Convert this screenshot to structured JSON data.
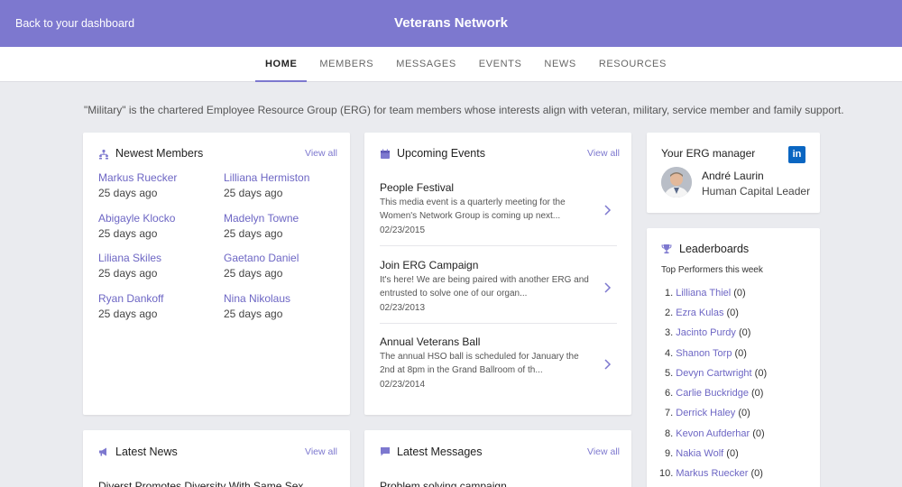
{
  "header": {
    "back_label": "Back to your dashboard",
    "title": "Veterans Network"
  },
  "nav": {
    "tabs": [
      "HOME",
      "MEMBERS",
      "MESSAGES",
      "EVENTS",
      "NEWS",
      "RESOURCES"
    ],
    "active_tab": "HOME"
  },
  "intro": "\"Military\" is the chartered Employee Resource Group (ERG) for team members whose interests align with veteran, military, service member and family support.",
  "newest_members": {
    "title": "Newest Members",
    "view_all": "View all",
    "members": [
      {
        "name": "Markus Ruecker",
        "joined": "25 days ago"
      },
      {
        "name": "Lilliana Hermiston",
        "joined": "25 days ago"
      },
      {
        "name": "Abigayle Klocko",
        "joined": "25 days ago"
      },
      {
        "name": "Madelyn Towne",
        "joined": "25 days ago"
      },
      {
        "name": "Liliana Skiles",
        "joined": "25 days ago"
      },
      {
        "name": "Gaetano Daniel",
        "joined": "25 days ago"
      },
      {
        "name": "Ryan Dankoff",
        "joined": "25 days ago"
      },
      {
        "name": "Nina Nikolaus",
        "joined": "25 days ago"
      }
    ]
  },
  "upcoming_events": {
    "title": "Upcoming Events",
    "view_all": "View all",
    "events": [
      {
        "title": "People Festival",
        "description": "This media event is a quarterly meeting for the Women's Network Group is coming up next...",
        "date": "02/23/2015"
      },
      {
        "title": "Join ERG Campaign",
        "description": "It's here! We are being paired with another ERG and entrusted to solve one of our organ...",
        "date": "02/23/2013"
      },
      {
        "title": "Annual Veterans Ball",
        "description": "The annual HSO ball is scheduled for January the 2nd at 8pm in the Grand Ballroom of th...",
        "date": "02/23/2014"
      }
    ]
  },
  "erg_manager": {
    "title": "Your ERG manager",
    "linkedin_label": "in",
    "name": "André Laurin",
    "role": "Human Capital Leader"
  },
  "leaderboards": {
    "title": "Leaderboards",
    "subtitle": "Top Performers this week",
    "entries": [
      {
        "rank": "1.",
        "name": "Lilliana Thiel",
        "score": "(0)"
      },
      {
        "rank": "2.",
        "name": "Ezra Kulas",
        "score": "(0)"
      },
      {
        "rank": "3.",
        "name": "Jacinto Purdy",
        "score": "(0)"
      },
      {
        "rank": "4.",
        "name": "Shanon Torp",
        "score": "(0)"
      },
      {
        "rank": "5.",
        "name": "Devyn Cartwright",
        "score": "(0)"
      },
      {
        "rank": "6.",
        "name": "Carlie Buckridge",
        "score": "(0)"
      },
      {
        "rank": "7.",
        "name": "Derrick Haley",
        "score": "(0)"
      },
      {
        "rank": "8.",
        "name": "Kevon Aufderhar",
        "score": "(0)"
      },
      {
        "rank": "9.",
        "name": "Nakia Wolf",
        "score": "(0)"
      },
      {
        "rank": "10.",
        "name": "Markus Ruecker",
        "score": "(0)"
      }
    ]
  },
  "latest_news": {
    "title": "Latest News",
    "view_all": "View all",
    "first_item": "Diverst Promotes Diversity With Same Sex"
  },
  "latest_messages": {
    "title": "Latest Messages",
    "view_all": "View all",
    "first_item": "Problem solving campaign"
  },
  "colors": {
    "accent": "#7d78cf",
    "link": "#6d66c4",
    "background": "#eaebef",
    "linkedin": "#0a66c2"
  },
  "icons": [
    "people-icon",
    "calendar-icon",
    "trophy-icon",
    "megaphone-icon",
    "chat-icon",
    "chevron-right-icon",
    "linkedin-icon"
  ]
}
